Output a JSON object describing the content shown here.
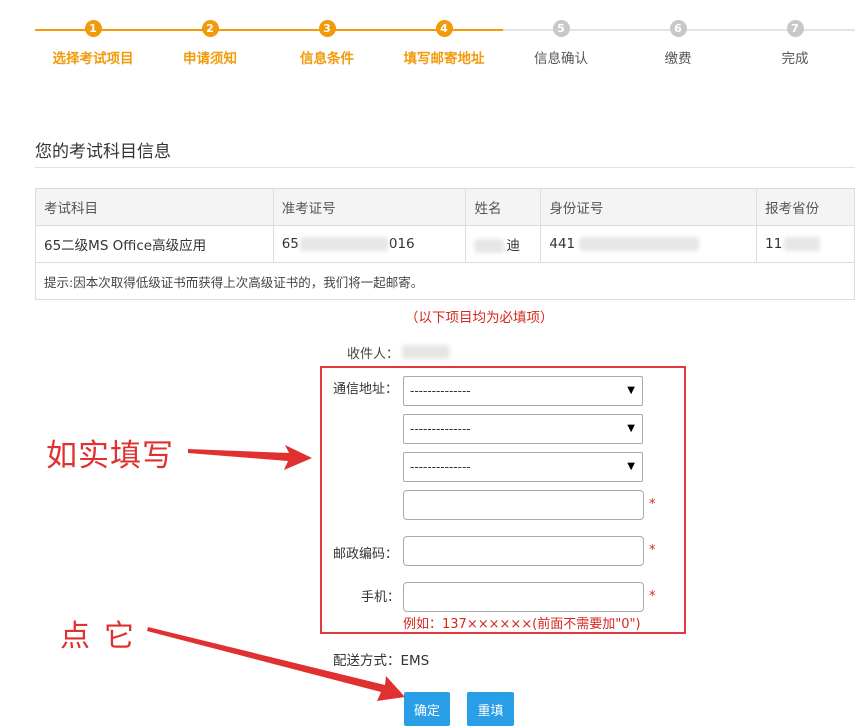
{
  "steps": [
    {
      "num": "1",
      "label": "选择考试项目",
      "state": "done"
    },
    {
      "num": "2",
      "label": "申请须知",
      "state": "done"
    },
    {
      "num": "3",
      "label": "信息条件",
      "state": "done"
    },
    {
      "num": "4",
      "label": "填写邮寄地址",
      "state": "done"
    },
    {
      "num": "5",
      "label": "信息确认",
      "state": "todo"
    },
    {
      "num": "6",
      "label": "缴费",
      "state": "todo"
    },
    {
      "num": "7",
      "label": "完成",
      "state": "todo"
    }
  ],
  "section_title": "您的考试科目信息",
  "table": {
    "headers": [
      "考试科目",
      "准考证号",
      "姓名",
      "身份证号",
      "报考省份"
    ],
    "row": {
      "subject": "65二级MS Office高级应用",
      "ticket_prefix": "65",
      "ticket_suffix": "016",
      "name_suffix": "迪",
      "id_prefix": "441",
      "province_prefix": "11"
    },
    "tip": "提示:因本次取得低级证书而获得上次高级证书的，我们将一起邮寄。"
  },
  "required_note": "（以下项目均为必填项）",
  "form": {
    "receiver_label": "收件人：",
    "address_label": "通信地址：",
    "select1": "--------------",
    "select2": "--------------",
    "select3": "--------------",
    "postcode_label": "邮政编码：",
    "phone_label": "手机：",
    "required_mark": "*",
    "phone_example": "例如：137××××××(前面不需要加\"0\")",
    "delivery": "配送方式：EMS"
  },
  "buttons": {
    "confirm": "确定",
    "reset": "重填"
  },
  "annotations": {
    "fill_truthfully": "如实填写",
    "click_it": "点它"
  },
  "colors": {
    "accent_orange": "#f29b0a",
    "annotation_red": "#e03030",
    "button_blue": "#2a9ee6"
  }
}
